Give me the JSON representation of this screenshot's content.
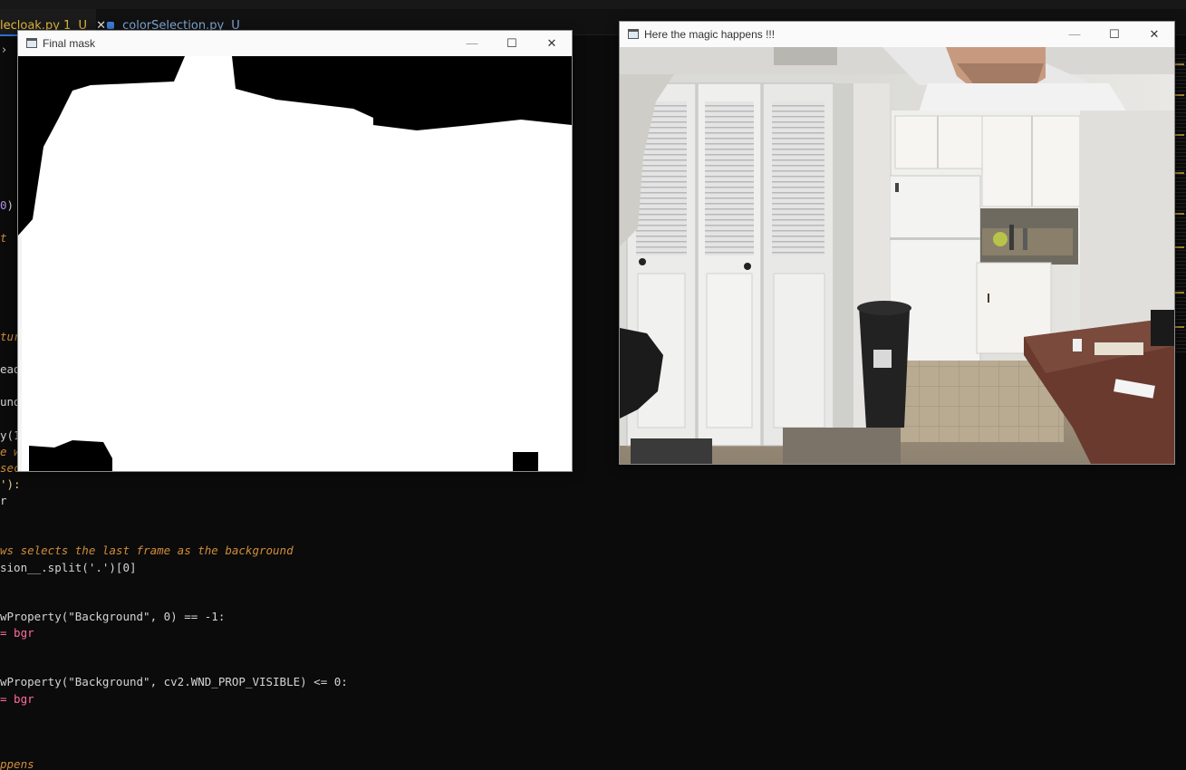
{
  "editor": {
    "tabs": [
      {
        "label": "lecloak.py 1",
        "modified": "U",
        "active": true
      },
      {
        "label": "colorSelection.py",
        "modified": "U",
        "active": false
      }
    ],
    "code_lines": [
      {
        "text": "0)"
      },
      {
        "text": "t",
        "kind": "comment"
      },
      {
        "text": "tur",
        "kind": "comment"
      },
      {
        "text": "ead"
      },
      {
        "text": "und"
      },
      {
        "text": "y(1"
      },
      {
        "text": "e w",
        "kind": "comment"
      },
      {
        "text": "seconds",
        "kind": "comment"
      },
      {
        "text": "'):"
      },
      {
        "text": "r"
      },
      {
        "text": "ws selects the last frame as the background",
        "kind": "comment"
      },
      {
        "text": "sion__.split('.')[0]"
      },
      {
        "text": "wProperty(\"Background\", 0) == -1:"
      },
      {
        "text": "= bgr"
      },
      {
        "text": "wProperty(\"Background\", cv2.WND_PROP_VISIBLE) <= 0:"
      },
      {
        "text": "= bgr"
      },
      {
        "text": "ppens",
        "kind": "comment"
      }
    ]
  },
  "mask_window": {
    "title": "Final mask",
    "controls": {
      "minimize": "—",
      "maximize": "☐",
      "close": "✕"
    }
  },
  "camera_window": {
    "title": "Here the magic happens !!!",
    "controls": {
      "minimize": "—",
      "maximize": "☐",
      "close": "✕"
    }
  },
  "colors": {
    "editor_bg": "#0b0b0b",
    "comment": "#d08c3a",
    "string": "#e9c891",
    "number": "#b492e6",
    "operator": "#ff6b9f",
    "active_tab_text": "#e2b93b"
  },
  "icons": [
    "python-file-icon",
    "window-app-icon",
    "minimize-icon",
    "maximize-icon",
    "close-icon",
    "chevron-right-icon"
  ]
}
